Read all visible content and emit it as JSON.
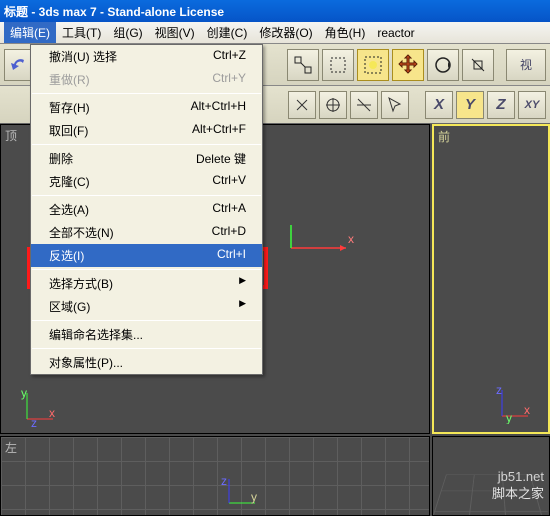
{
  "title": "标题 - 3ds max 7 - Stand-alone License",
  "menubar": [
    {
      "label": "编辑(E)",
      "active": true
    },
    {
      "label": "工具(T)"
    },
    {
      "label": "组(G)"
    },
    {
      "label": "视图(V)"
    },
    {
      "label": "创建(C)"
    },
    {
      "label": "修改器(O)"
    },
    {
      "label": "角色(H)"
    },
    {
      "label": "reactor"
    }
  ],
  "edit_menu": {
    "items": [
      {
        "label": "撤消(U) 选择",
        "shortcut": "Ctrl+Z"
      },
      {
        "label": "重做(R)",
        "shortcut": "Ctrl+Y",
        "disabled": true
      },
      {
        "sep": true
      },
      {
        "label": "暂存(H)",
        "shortcut": "Alt+Ctrl+H"
      },
      {
        "label": "取回(F)",
        "shortcut": "Alt+Ctrl+F"
      },
      {
        "sep": true
      },
      {
        "label": "删除",
        "shortcut": "Delete 键"
      },
      {
        "label": "克隆(C)",
        "shortcut": "Ctrl+V"
      },
      {
        "sep": true
      },
      {
        "label": "全选(A)",
        "shortcut": "Ctrl+A"
      },
      {
        "label": "全部不选(N)",
        "shortcut": "Ctrl+D"
      },
      {
        "label": "反选(I)",
        "shortcut": "Ctrl+I",
        "highlight": true
      },
      {
        "sep": true
      },
      {
        "label": "选择方式(B)",
        "submenu": true
      },
      {
        "label": "区域(G)",
        "submenu": true
      },
      {
        "sep": true
      },
      {
        "label": "编辑命名选择集..."
      },
      {
        "sep": true
      },
      {
        "label": "对象属性(P)..."
      }
    ]
  },
  "axes": {
    "x": "X",
    "y": "Y",
    "z": "Z"
  },
  "viewport_labels": {
    "top": "顶",
    "front": "前",
    "left": "左"
  },
  "gizmo": {
    "x": "x",
    "y": "y",
    "z": "z"
  },
  "watermark1": "jb51.net",
  "watermark2": "脚本之家"
}
